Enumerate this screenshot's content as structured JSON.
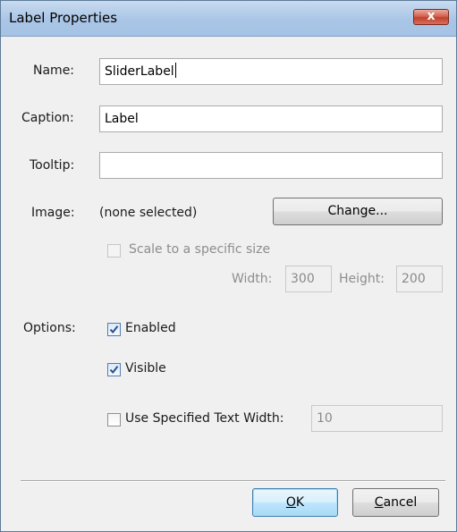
{
  "window": {
    "title": "Label Properties",
    "close_label": "x"
  },
  "form": {
    "name": {
      "label": "Name:",
      "value": "SliderLabel"
    },
    "caption": {
      "label": "Caption:",
      "value": "Label"
    },
    "tooltip": {
      "label": "Tooltip:",
      "value": ""
    },
    "image": {
      "label": "Image:",
      "value": "(none selected)",
      "change_button": "Change..."
    },
    "scale": {
      "label": "Scale to a specific size",
      "checked": false,
      "enabled": false
    },
    "size": {
      "width_label": "Width:",
      "width_value": "300",
      "height_label": "Height:",
      "height_value": "200"
    },
    "options": {
      "label": "Options:",
      "enabled": {
        "label": "Enabled",
        "checked": true
      },
      "visible": {
        "label": "Visible",
        "checked": true
      },
      "text_width": {
        "label": "Use Specified Text Width:",
        "checked": false,
        "value": "10"
      }
    }
  },
  "buttons": {
    "ok_accel": "O",
    "ok_rest": "K",
    "cancel_accel": "C",
    "cancel_rest": "ancel"
  },
  "colors": {
    "titlebar": "#a9c5e6",
    "close_button": "#c1422d",
    "check_mark": "#2a4f8f"
  }
}
